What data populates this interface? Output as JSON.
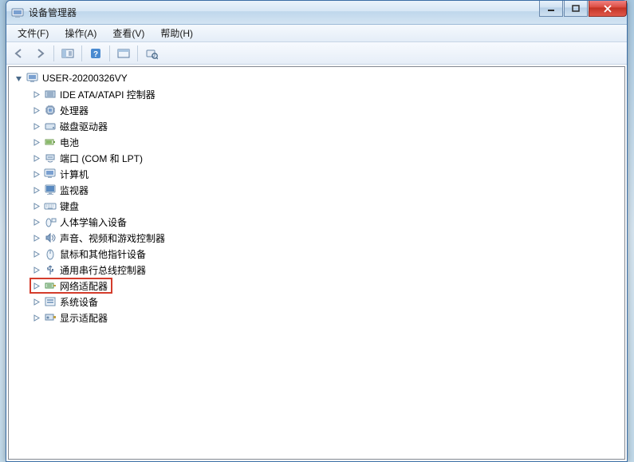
{
  "title": "设备管理器",
  "menus": {
    "file": "文件(F)",
    "action": "操作(A)",
    "view": "查看(V)",
    "help": "帮助(H)"
  },
  "tree": {
    "root": "USER-20200326VY",
    "items": [
      "IDE ATA/ATAPI 控制器",
      "处理器",
      "磁盘驱动器",
      "电池",
      "端口 (COM 和 LPT)",
      "计算机",
      "监视器",
      "键盘",
      "人体学输入设备",
      "声音、视频和游戏控制器",
      "鼠标和其他指针设备",
      "通用串行总线控制器",
      "网络适配器",
      "系统设备",
      "显示适配器"
    ],
    "highlighted_index": 12
  },
  "icons": {
    "root": "computer-icon",
    "items": [
      "ide-controller-icon",
      "processor-icon",
      "disk-drive-icon",
      "battery-icon",
      "port-icon",
      "computer-icon",
      "monitor-icon",
      "keyboard-icon",
      "hid-icon",
      "sound-icon",
      "mouse-icon",
      "usb-icon",
      "network-adapter-icon",
      "system-device-icon",
      "display-adapter-icon"
    ]
  }
}
